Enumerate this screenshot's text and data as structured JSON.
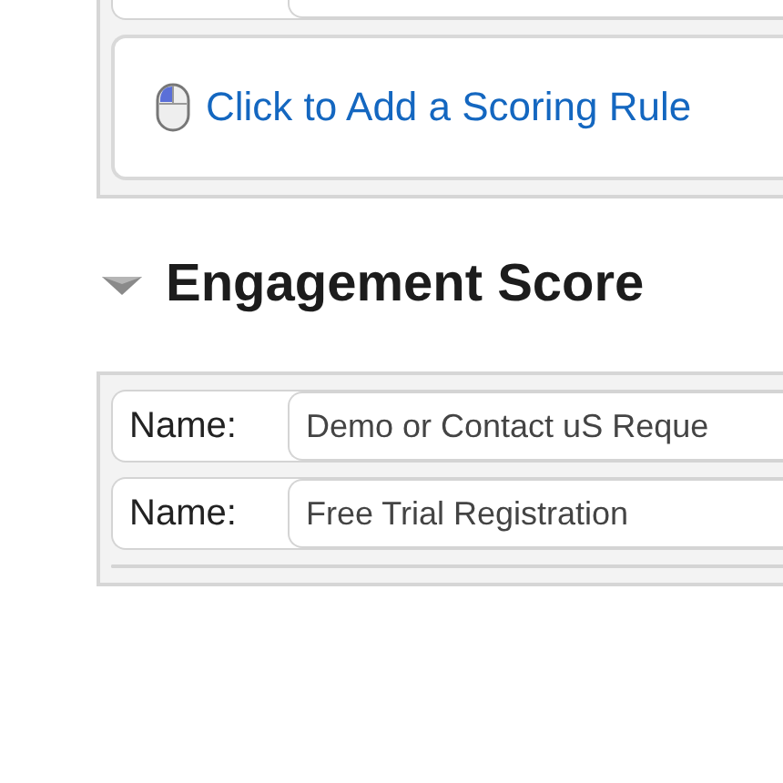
{
  "sections": [
    {
      "cards": [
        {
          "kind": "field"
        },
        {
          "kind": "add_rule",
          "label": "Click to Add a Scoring Rule"
        }
      ]
    },
    {
      "title": "Engagement Score",
      "expanded": true,
      "cards": [
        {
          "kind": "field",
          "label": "Name:",
          "value": "Demo or Contact uS Reque"
        },
        {
          "kind": "field",
          "label": "Name:",
          "value": "Free Trial Registration"
        },
        {
          "kind": "field"
        }
      ]
    }
  ]
}
